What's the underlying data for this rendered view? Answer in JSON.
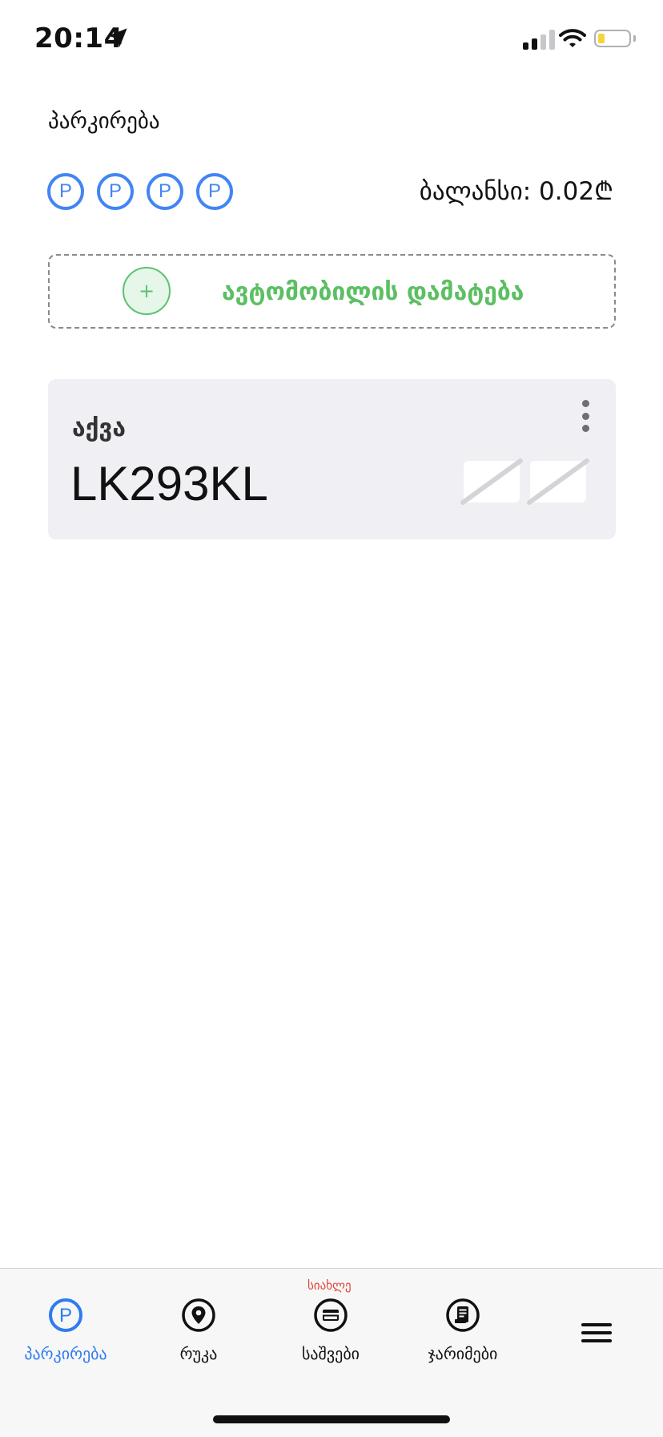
{
  "status_bar": {
    "time": "20:14",
    "icons": [
      "location-arrow-icon",
      "cellular-signal-icon",
      "wifi-icon",
      "battery-icon"
    ]
  },
  "header": {
    "title": "პარკირება",
    "parking_icons": [
      "P",
      "P",
      "P",
      "P"
    ],
    "balance": "ბალანსი: 0.02₾"
  },
  "add_car": {
    "icon": "+",
    "label": "ავტომობილის დამატება"
  },
  "car": {
    "name": "აქვა",
    "plate": "LK293KL",
    "more_icon": "kebab-menu-icon"
  },
  "tab_bar": {
    "new_badge": "სიახლე",
    "tabs": [
      {
        "label": "პარკირება",
        "icon": "parking-icon",
        "active": true
      },
      {
        "label": "რუკა",
        "icon": "map-pin-icon",
        "active": false
      },
      {
        "label": "საშვები",
        "icon": "card-icon",
        "active": false
      },
      {
        "label": "ჯარიმები",
        "icon": "receipt-icon",
        "active": false
      }
    ],
    "menu_icon": "hamburger-menu-icon"
  },
  "colors": {
    "accent_blue": "#4285f4",
    "add_green": "#5cbf63",
    "badge_red": "#e0453a",
    "card_bg": "#efeff4"
  }
}
